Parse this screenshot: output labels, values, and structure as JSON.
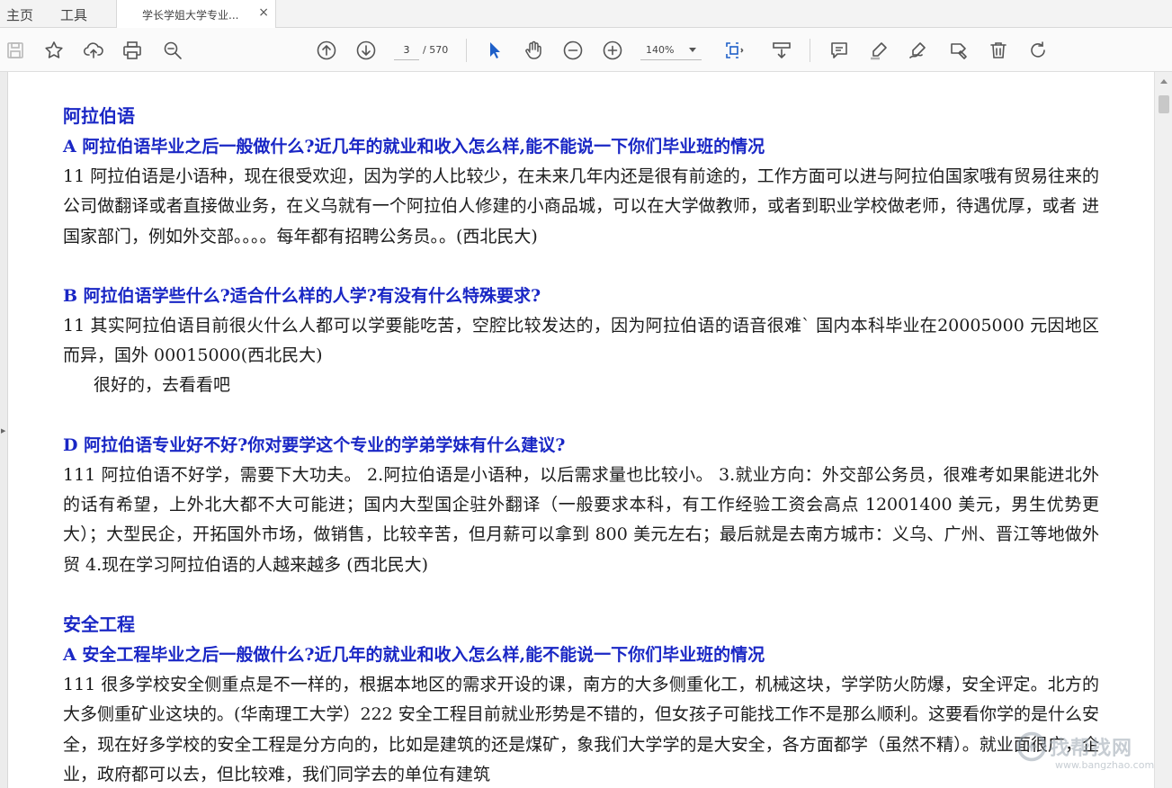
{
  "menu": {
    "home": "主页",
    "tools": "工具"
  },
  "tab": {
    "title": "学长学姐大学专业...",
    "close": "×"
  },
  "toolbar": {
    "page_current": "3",
    "page_total": "/ 570",
    "zoom": "140%"
  },
  "document": {
    "sections": [
      {
        "title": "阿拉伯语",
        "blocks": [
          {
            "q": "A 阿拉伯语毕业之后一般做什么?近几年的就业和收入怎么样,能不能说一下你们毕业班的情况",
            "a": "11 阿拉伯语是小语种，现在很受欢迎，因为学的人比较少，在未来几年内还是很有前途的，工作方面可以进与阿拉伯国家哦有贸易往来的公司做翻译或者直接做业务，在义乌就有一个阿拉伯人修建的小商品城，可以在大学做教师，或者到职业学校做老师，待遇优厚，或者 进国家部门，例如外交部。。。。每年都有招聘公务员。。(西北民大)"
          },
          {
            "q": "B 阿拉伯语学些什么?适合什么样的人学?有没有什么特殊要求?",
            "a": "11  其实阿拉伯语目前很火什么人都可以学要能吃苦，空腔比较发达的，因为阿拉伯语的语音很难` 国内本科毕业在20005000 元因地区而异，国外 00015000(西北民大)",
            "extra": "很好的，去看看吧"
          },
          {
            "q": "D 阿拉伯语专业好不好?你对要学这个专业的学弟学妹有什么建议?",
            "a": "111 阿拉伯语不好学，需要下大功夫。 2.阿拉伯语是小语种，以后需求量也比较小。 3.就业方向：外交部公务员，很难考如果能进北外的话有希望，上外北大都不大可能进；国内大型国企驻外翻译（一般要求本科，有工作经验工资会高点 12001400 美元，男生优势更大）；大型民企，开拓国外市场，做销售，比较辛苦，但月薪可以拿到 800 美元左右；最后就是去南方城市：义乌、广州、晋江等地做外贸 4.现在学习阿拉伯语的人越来越多 (西北民大)"
          }
        ]
      },
      {
        "title": "安全工程",
        "blocks": [
          {
            "q": "A 安全工程毕业之后一般做什么?近几年的就业和收入怎么样,能不能说一下你们毕业班的情况",
            "a": "111 很多学校安全侧重点是不一样的，根据本地区的需求开设的课，南方的大多侧重化工，机械这块，学学防火防爆，安全评定。北方的大多侧重矿业这块的。(华南理工大学）222 安全工程目前就业形势是不错的，但女孩子可能找工作不是那么顺利。这要看你学的是什么安全，现在好多学校的安全工程是分方向的，比如是建筑的还是煤矿，象我们大学学的是大安全，各方面都学（虽然不精）。就业面很广，企业，政府都可以去，但比较难，我们同学去的单位有建筑"
          }
        ]
      }
    ]
  },
  "watermark": {
    "brand": "找帮找网",
    "url": "www.bangzhao.com"
  }
}
